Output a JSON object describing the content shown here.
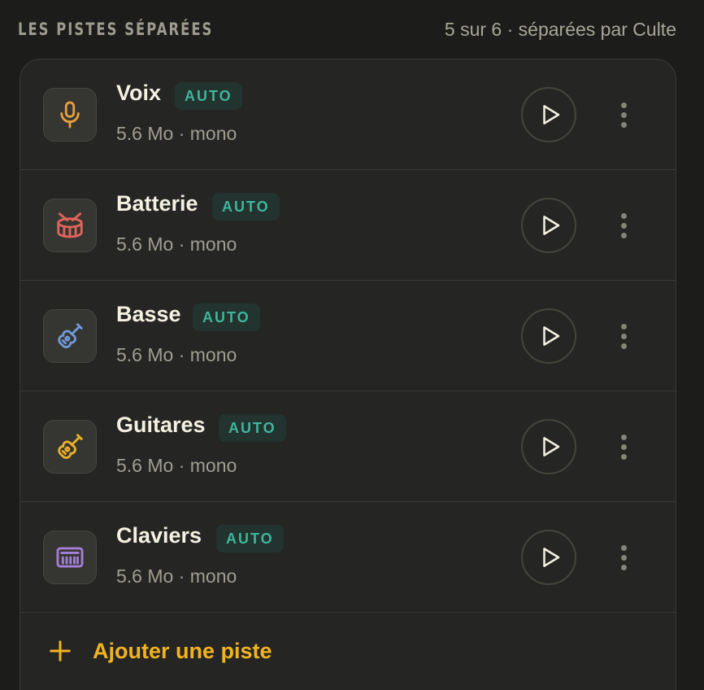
{
  "header": {
    "title": "LES PISTES SÉPARÉES",
    "meta": "5 sur 6 · séparées par Culte"
  },
  "tracks": [
    {
      "name": "Voix",
      "badge": "AUTO",
      "meta": "5.6 Mo · mono",
      "icon": "microphone-icon",
      "color": "#e6a03c"
    },
    {
      "name": "Batterie",
      "badge": "AUTO",
      "meta": "5.6 Mo · mono",
      "icon": "drum-icon",
      "color": "#e0645a"
    },
    {
      "name": "Basse",
      "badge": "AUTO",
      "meta": "5.6 Mo · mono",
      "icon": "bass-guitar-icon",
      "color": "#6f9ad8"
    },
    {
      "name": "Guitares",
      "badge": "AUTO",
      "meta": "5.6 Mo · mono",
      "icon": "guitar-icon",
      "color": "#eab02a"
    },
    {
      "name": "Claviers",
      "badge": "AUTO",
      "meta": "5.6 Mo · mono",
      "icon": "keyboard-icon",
      "color": "#a57fd6"
    }
  ],
  "add_track": {
    "label": "Ajouter une piste",
    "color": "#f2b320"
  },
  "colors": {
    "badge_text": "#3fb59c",
    "play_icon": "#f4f0e2"
  }
}
